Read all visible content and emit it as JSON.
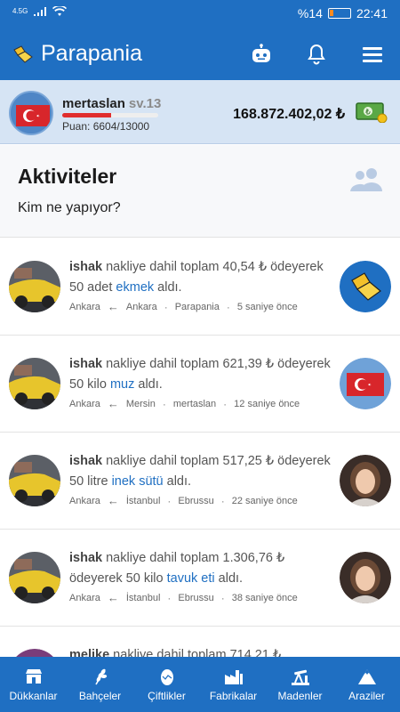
{
  "status_bar": {
    "network": "4.5G",
    "battery": "%14",
    "time": "22:41"
  },
  "app": {
    "title": "Parapania"
  },
  "profile": {
    "username": "mertaslan",
    "level": "sv.13",
    "points": "Puan: 6604/13000",
    "xp_fraction": 0.51,
    "balance": "168.872.402,02 ₺"
  },
  "activities": {
    "title": "Aktiviteler",
    "subtitle": "Kim ne yapıyor?"
  },
  "feed": [
    {
      "who": "ishak",
      "pre": " nakliye dahil toplam 40,54 ₺ ödeyerek 50 adet ",
      "product": "ekmek",
      "post": " aldı.",
      "from": "Ankara",
      "to": "Ankara",
      "seller": "Parapania",
      "time": "5 saniye önce"
    },
    {
      "who": "ishak",
      "pre": " nakliye dahil toplam 621,39 ₺ ödeyerek 50 kilo ",
      "product": "muz",
      "post": " aldı.",
      "from": "Ankara",
      "to": "Mersin",
      "seller": "mertaslan",
      "time": "12 saniye önce"
    },
    {
      "who": "ishak",
      "pre": " nakliye dahil toplam 517,25 ₺ ödeyerek 50 litre ",
      "product": "inek sütü",
      "post": " aldı.",
      "from": "Ankara",
      "to": "İstanbul",
      "seller": "Ebrussu",
      "time": "22 saniye önce"
    },
    {
      "who": "ishak",
      "pre": " nakliye dahil toplam 1.306,76 ₺ ödeyerek 50 kilo ",
      "product": "tavuk eti",
      "post": " aldı.",
      "from": "Ankara",
      "to": "İstanbul",
      "seller": "Ebrussu",
      "time": "38 saniye önce"
    },
    {
      "who": "melike",
      "pre": " nakliye dahil toplam 714,21 ₺",
      "product": "",
      "post": "",
      "from": "",
      "to": "",
      "seller": "",
      "time": ""
    }
  ],
  "bottom_nav": [
    {
      "label": "Dükkanlar",
      "icon": "store-icon"
    },
    {
      "label": "Bahçeler",
      "icon": "wheat-icon"
    },
    {
      "label": "Çiftlikler",
      "icon": "egg-icon"
    },
    {
      "label": "Fabrikalar",
      "icon": "factory-icon"
    },
    {
      "label": "Madenler",
      "icon": "oil-pump-icon"
    },
    {
      "label": "Araziler",
      "icon": "mountain-icon"
    }
  ],
  "colors": {
    "primary": "#1f6fc2",
    "accent_product": "#1f6fc2",
    "xp_red": "#e02d2d",
    "profile_bg": "#d6e4f4"
  }
}
